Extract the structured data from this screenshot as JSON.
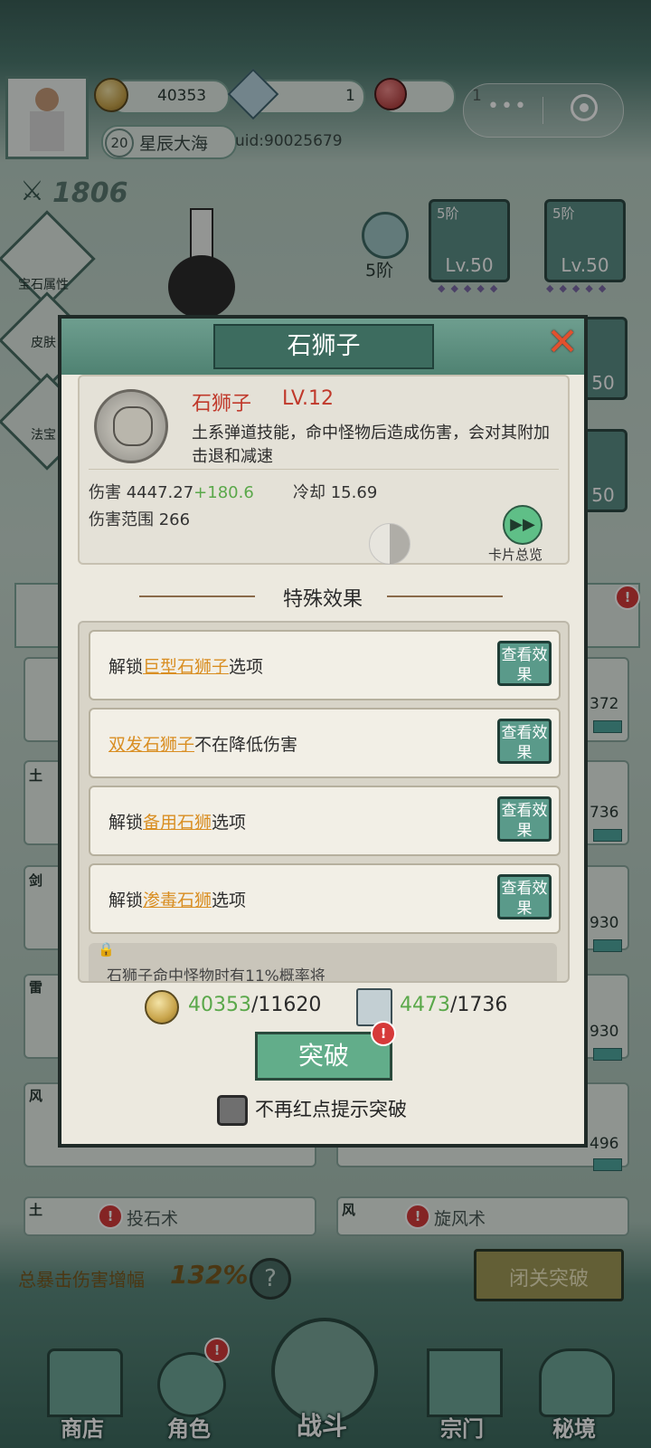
{
  "header": {
    "coins": "40353",
    "gems": "1",
    "orbs": "1",
    "player_level": "20",
    "player_name": "星辰大海",
    "uid": "uid:90025679",
    "power": "1806",
    "menu_dots": "•••",
    "record_icon": "target-icon"
  },
  "left_menu": [
    {
      "label": "宝石属性"
    },
    {
      "label": "皮肤"
    },
    {
      "label": "法宝"
    }
  ],
  "equipment": {
    "rank_label": "5阶",
    "cards": [
      {
        "tag": "5阶",
        "level": "Lv.50"
      },
      {
        "tag": "5阶",
        "level": "Lv.50"
      },
      {
        "tag": "",
        "level": "50"
      },
      {
        "tag": "",
        "level": "50"
      }
    ]
  },
  "skill_list": {
    "right_values": [
      "372",
      "736",
      "930",
      "930",
      "496"
    ],
    "elements": [
      "土",
      "剑",
      "雷",
      "风"
    ],
    "bottom_skills": [
      {
        "element": "土",
        "name": "投石术"
      },
      {
        "element": "风",
        "name": "旋风术"
      }
    ],
    "total_crit_label": "总暴击伤害增幅",
    "total_crit_value": "132%",
    "closed_breakthrough_label": "闭关突破"
  },
  "bottom_nav": [
    {
      "label": "商店"
    },
    {
      "label": "角色"
    },
    {
      "label": "战斗"
    },
    {
      "label": "宗门"
    },
    {
      "label": "秘境"
    }
  ],
  "modal": {
    "title": "石狮子",
    "skill_name": "石狮子",
    "skill_level": "LV.12",
    "description": "土系弹道技能，命中怪物后造成伤害，会对其附加击退和减速",
    "damage_label": "伤害",
    "damage_value": "4447.27",
    "damage_bonus": "+180.6",
    "cooldown_label": "冷却",
    "cooldown_value": "15.69",
    "range_label": "伤害范围",
    "range_value": "266",
    "card_overview_label": "卡片总览",
    "special_effects_title": "特殊效果",
    "view_effect_label": "查看效果",
    "effects": [
      {
        "prefix": "解锁",
        "highlight": "巨型石狮子",
        "suffix": "选项"
      },
      {
        "prefix": "",
        "highlight": "双发石狮子",
        "suffix": "不在降低伤害"
      },
      {
        "prefix": "解锁",
        "highlight": "备用石狮",
        "suffix": "选项"
      },
      {
        "prefix": "解锁",
        "highlight": "渗毒石狮",
        "suffix": "选项"
      }
    ],
    "locked_effect_text": "石狮子命中怪物时有11%概率将",
    "cost_coins_have": "40353",
    "cost_coins_need": "/11620",
    "cost_scrolls_have": "4473",
    "cost_scrolls_need": "/1736",
    "breakthrough_label": "突破",
    "no_reminder_label": "不再红点提示突破"
  }
}
